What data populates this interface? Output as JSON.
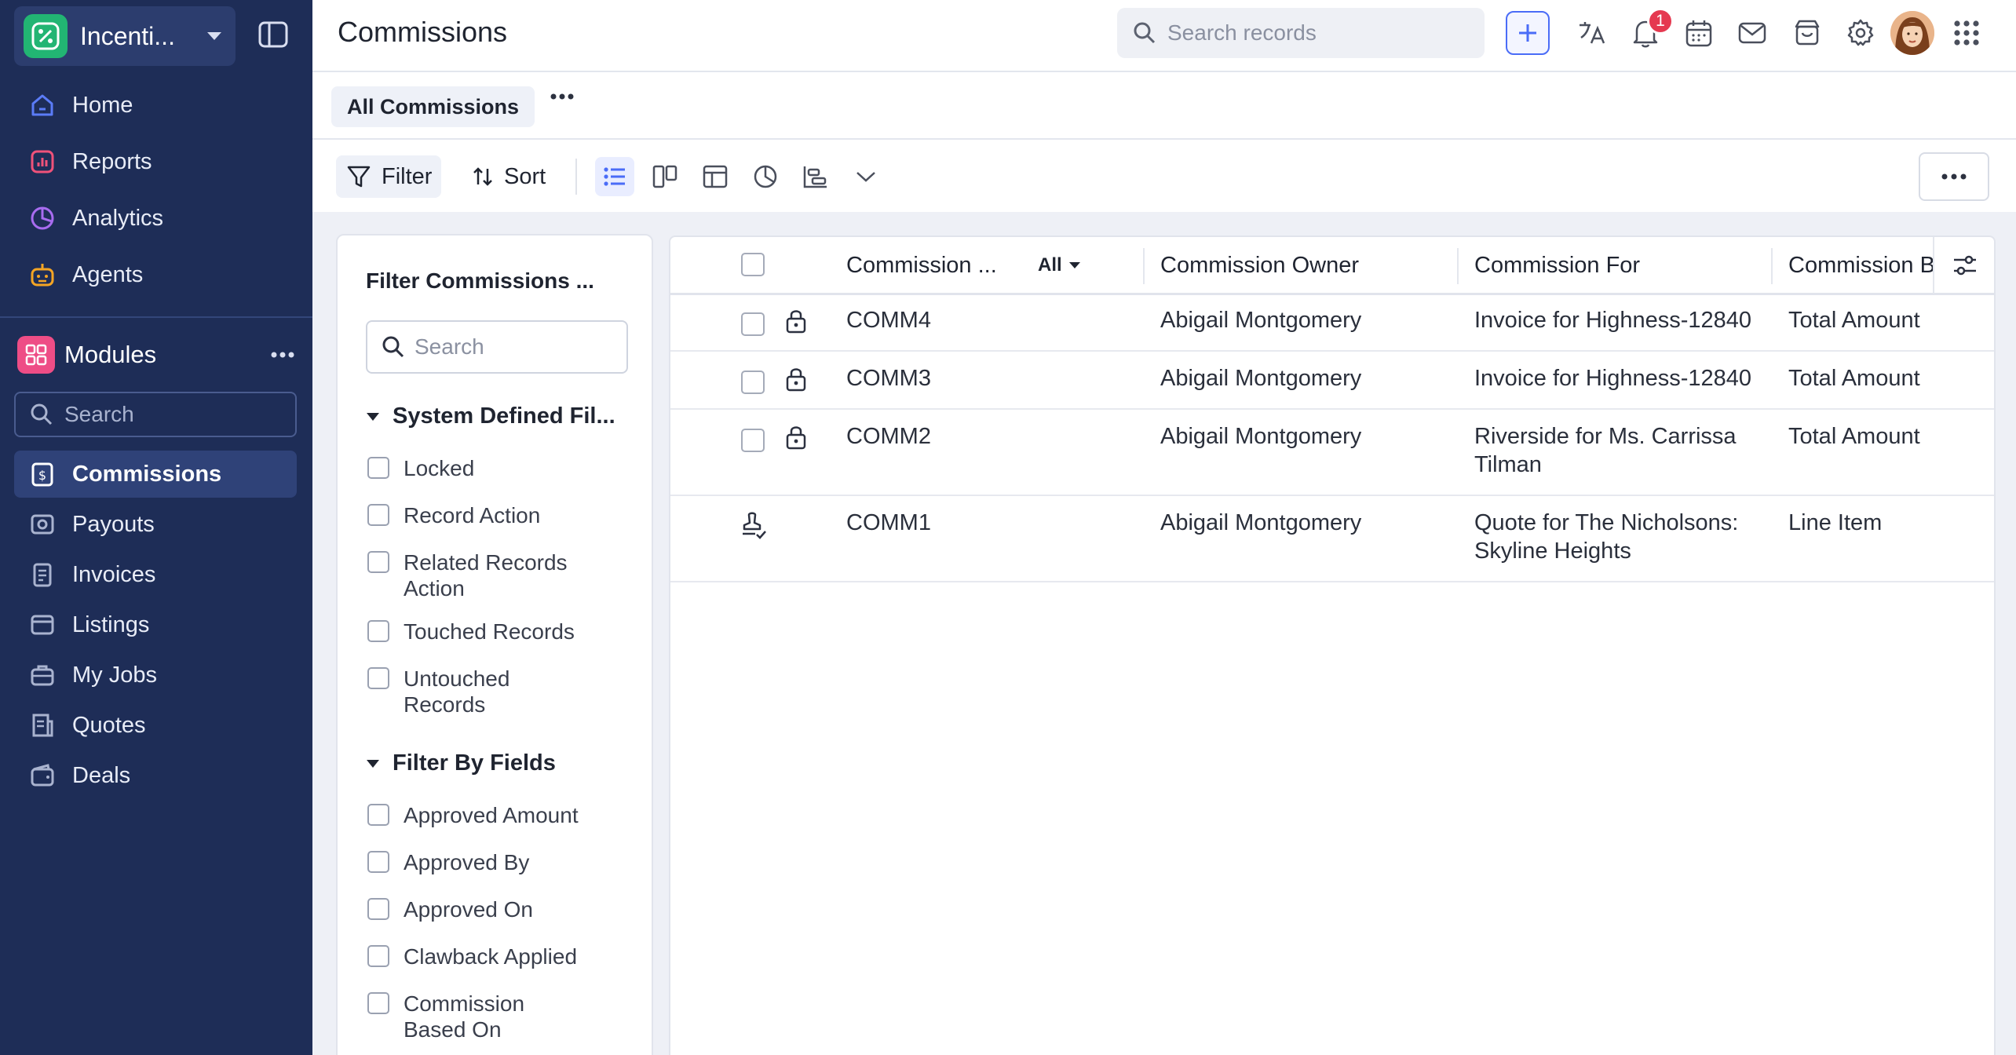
{
  "colors": {
    "sidebar_bg": "#1e2d57",
    "accent": "#4a6cf7",
    "badge": "#e53950",
    "app_logo": "#22b573",
    "modules": "#ee4d86"
  },
  "app": {
    "name": "Incenti...",
    "logo_icon": "percent-badge-icon"
  },
  "sidebar": {
    "top_items": [
      {
        "label": "Home",
        "icon": "home-icon"
      },
      {
        "label": "Reports",
        "icon": "reports-icon"
      },
      {
        "label": "Analytics",
        "icon": "analytics-icon"
      },
      {
        "label": "Agents",
        "icon": "agent-robot-icon"
      }
    ],
    "modules_label": "Modules",
    "search_placeholder": "Search",
    "module_items": [
      {
        "label": "Commissions",
        "icon": "commission-icon",
        "active": true
      },
      {
        "label": "Payouts",
        "icon": "payout-icon"
      },
      {
        "label": "Invoices",
        "icon": "invoice-icon"
      },
      {
        "label": "Listings",
        "icon": "listing-icon"
      },
      {
        "label": "My Jobs",
        "icon": "briefcase-icon"
      },
      {
        "label": "Quotes",
        "icon": "quote-icon"
      },
      {
        "label": "Deals",
        "icon": "wallet-icon"
      }
    ]
  },
  "header": {
    "title": "Commissions",
    "search_placeholder": "Search records",
    "notification_count": "1"
  },
  "views": {
    "active_tab": "All Commissions"
  },
  "toolbar": {
    "filter_label": "Filter",
    "sort_label": "Sort"
  },
  "filter_panel": {
    "title": "Filter Commissions ...",
    "search_placeholder": "Search",
    "system_section": "System Defined Fil...",
    "system_items": [
      "Locked",
      "Record Action",
      "Related Records Action",
      "Touched Records",
      "Untouched Records"
    ],
    "fields_section": "Filter By Fields",
    "field_items": [
      "Approved Amount",
      "Approved By",
      "Approved On",
      "Clawback Applied",
      "Commission Based On"
    ]
  },
  "table": {
    "columns": [
      "Commission ...",
      "Commission Owner",
      "Commission For",
      "Commission B"
    ],
    "all_filter": "All",
    "rows": [
      {
        "id": "COMM4",
        "owner": "Abigail Montgomery",
        "for": "Invoice for Highness-12840",
        "based": "Total Amount",
        "icon": "lock-icon"
      },
      {
        "id": "COMM3",
        "owner": "Abigail Montgomery",
        "for": "Invoice for Highness-12840",
        "based": "Total Amount",
        "icon": "lock-icon"
      },
      {
        "id": "COMM2",
        "owner": "Abigail Montgomery",
        "for": "Riverside for Ms. Carrissa Tilman",
        "based": "Total Amount",
        "icon": "lock-icon"
      },
      {
        "id": "COMM1",
        "owner": "Abigail Montgomery",
        "for": "Quote for The Nicholsons: Skyline Heights",
        "based": "Line Item",
        "icon": "approval-stamp-icon"
      }
    ]
  }
}
